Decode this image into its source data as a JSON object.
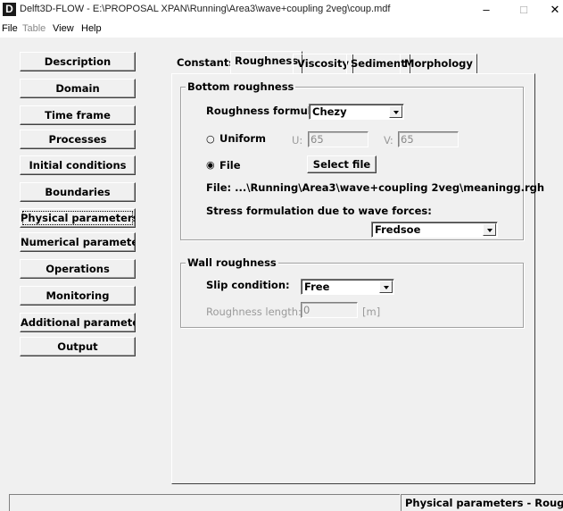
{
  "window": {
    "title": "Delft3D-FLOW - E:\\PROPOSAL XPAN\\Running\\Area3\\wave+coupling 2veg\\coup.mdf",
    "app_icon": "D",
    "minimize": "–",
    "maximize": "□",
    "close": "✕"
  },
  "menu": {
    "file": "File",
    "table": "Table",
    "view": "View",
    "help": "Help"
  },
  "sidebar": {
    "items": [
      {
        "label": "Description"
      },
      {
        "label": "Domain"
      },
      {
        "label": "Time frame"
      },
      {
        "label": "Processes"
      },
      {
        "label": "Initial conditions"
      },
      {
        "label": "Boundaries"
      },
      {
        "label": "Physical parameters"
      },
      {
        "label": "Numerical parameters"
      },
      {
        "label": "Operations"
      },
      {
        "label": "Monitoring"
      },
      {
        "label": "Additional parameters"
      },
      {
        "label": "Output"
      }
    ],
    "active_index": 6
  },
  "tabs": [
    {
      "label": "Constants"
    },
    {
      "label": "Roughness"
    },
    {
      "label": "Viscosity"
    },
    {
      "label": "Sediment"
    },
    {
      "label": "Morphology"
    }
  ],
  "bottom_roughness": {
    "legend": "Bottom roughness",
    "formula_label": "Roughness formula:",
    "formula_value": "Chezy",
    "uniform_label": "Uniform",
    "u_label": "U:",
    "u_value": "65",
    "v_label": "V:",
    "v_value": "65",
    "file_label": "File",
    "select_file_button": "Select file",
    "file_path_text": "File:  ...\\Running\\Area3\\wave+coupling 2veg\\meaningg.rgh",
    "stress_label": "Stress formulation due to wave forces:",
    "stress_value": "Fredsoe",
    "selected_option": "File"
  },
  "wall_roughness": {
    "legend": "Wall roughness",
    "slip_label": "Slip condition:",
    "slip_value": "Free",
    "length_label": "Roughness length:",
    "length_value": "0",
    "length_unit": "[m]"
  },
  "statusbar": {
    "left": "",
    "right": "Physical parameters - Roughness"
  }
}
